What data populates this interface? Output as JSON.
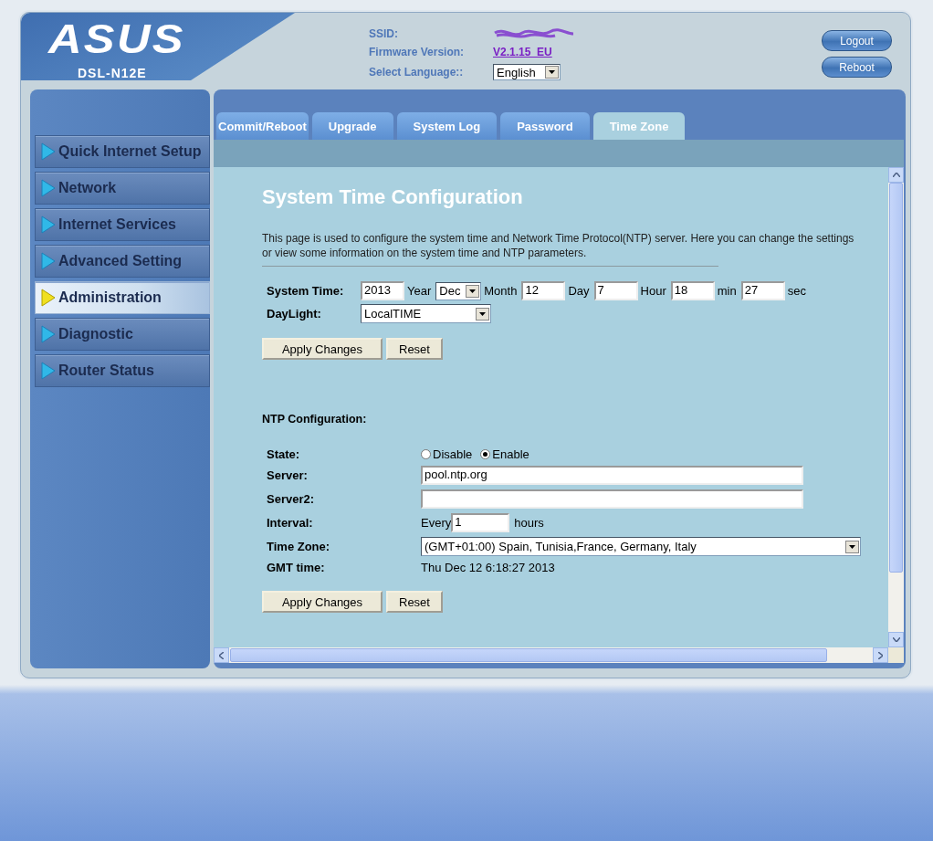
{
  "header": {
    "logo": "ASUS",
    "model": "DSL-N12E",
    "ssid_label": "SSID:",
    "firmware_label": "Firmware Version:",
    "firmware_version": "V2.1.15_EU",
    "language_label": "Select Language::",
    "language": "English",
    "buttons": [
      "Logout",
      "Reboot"
    ]
  },
  "sidebar": {
    "items": [
      {
        "label": "Quick Internet Setup",
        "selected": false
      },
      {
        "label": "Network",
        "selected": false
      },
      {
        "label": "Internet Services",
        "selected": false
      },
      {
        "label": "Advanced Setting",
        "selected": false
      },
      {
        "label": "Administration",
        "selected": true
      },
      {
        "label": "Diagnostic",
        "selected": false
      },
      {
        "label": "Router Status",
        "selected": false
      }
    ]
  },
  "tabs": [
    {
      "label": "Commit/Reboot",
      "selected": false
    },
    {
      "label": "Upgrade",
      "selected": false
    },
    {
      "label": "System Log",
      "selected": false
    },
    {
      "label": "Password",
      "selected": false
    },
    {
      "label": "Time Zone",
      "selected": true
    }
  ],
  "page": {
    "title": "System Time Configuration",
    "description": "This page is used to configure the system time and Network Time Protocol(NTP) server. Here you can change the settings or view some information on the system time and NTP parameters.",
    "system_time": {
      "label": "System Time:",
      "parts": [
        {
          "kind": "input",
          "value": "2013"
        },
        {
          "kind": "text",
          "text": "Year"
        },
        {
          "kind": "select",
          "value": "Dec"
        },
        {
          "kind": "text",
          "text": "Month"
        },
        {
          "kind": "input",
          "value": "12"
        },
        {
          "kind": "text",
          "text": "Day"
        },
        {
          "kind": "input",
          "value": "7"
        },
        {
          "kind": "text",
          "text": "Hour"
        },
        {
          "kind": "input",
          "value": "18"
        },
        {
          "kind": "text",
          "text": "min"
        },
        {
          "kind": "input",
          "value": "27"
        },
        {
          "kind": "text",
          "text": "sec"
        }
      ]
    },
    "daylight": {
      "label": "DayLight:",
      "value": "LocalTIME"
    },
    "buttons": [
      "Apply Changes",
      "Reset"
    ],
    "ntp": {
      "title": "NTP Configuration:",
      "state_label": "State:",
      "states": [
        {
          "label": "Disable",
          "selected": false
        },
        {
          "label": "Enable",
          "selected": true
        }
      ],
      "server_label": "Server:",
      "server": "pool.ntp.org",
      "server2_label": "Server2:",
      "interval_label": "Interval:",
      "interval_prefix": "Every",
      "interval": "1",
      "interval_unit": "hours",
      "timezone_label": "Time Zone:",
      "timezone": "(GMT+01:00) Spain, Tunisia,France, Germany, Italy",
      "gmt_label": "GMT time:",
      "gmt_time": "Thu Dec 12 6:18:27 2013",
      "buttons": [
        "Apply Changes",
        "Reset"
      ]
    }
  }
}
